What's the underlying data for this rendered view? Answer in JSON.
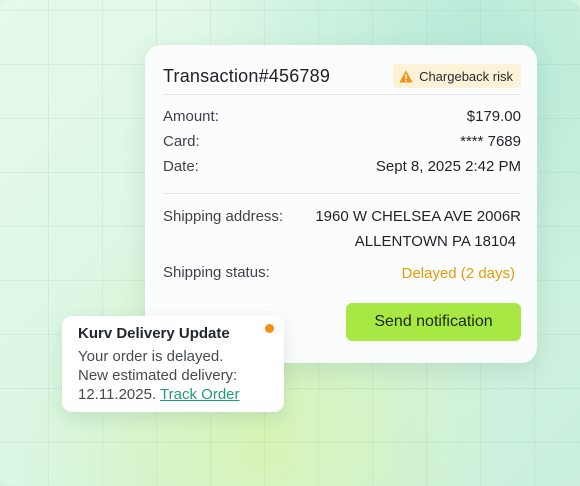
{
  "transaction": {
    "title": "Transaction#456789",
    "badge": {
      "label": "Chargeback risk",
      "icon": "warning-icon",
      "color": "#f5920f"
    },
    "amount": {
      "label": "Amount:",
      "value": "$179.00"
    },
    "card": {
      "label": "Card:",
      "value": "**** 7689"
    },
    "date": {
      "label": "Date:",
      "value": "Sept 8, 2025 2:42 PM"
    },
    "shipping_address": {
      "label": "Shipping address:",
      "line1": "1960 W CHELSEA AVE 2006R",
      "line2": "ALLENTOWN PA 18104"
    },
    "shipping_status": {
      "label": "Shipping status:",
      "value": "Delayed (2 days)",
      "color": "#e59a0c"
    },
    "send_button": {
      "label": "Send notification",
      "color": "#a8e845"
    }
  },
  "toast": {
    "title": "Kurv Delivery Update",
    "line1": "Your order is delayed.",
    "line2": "New estimated delivery:",
    "date": "12.11.2025.",
    "link": "Track Order",
    "status_dot_color": "#f5920f"
  }
}
